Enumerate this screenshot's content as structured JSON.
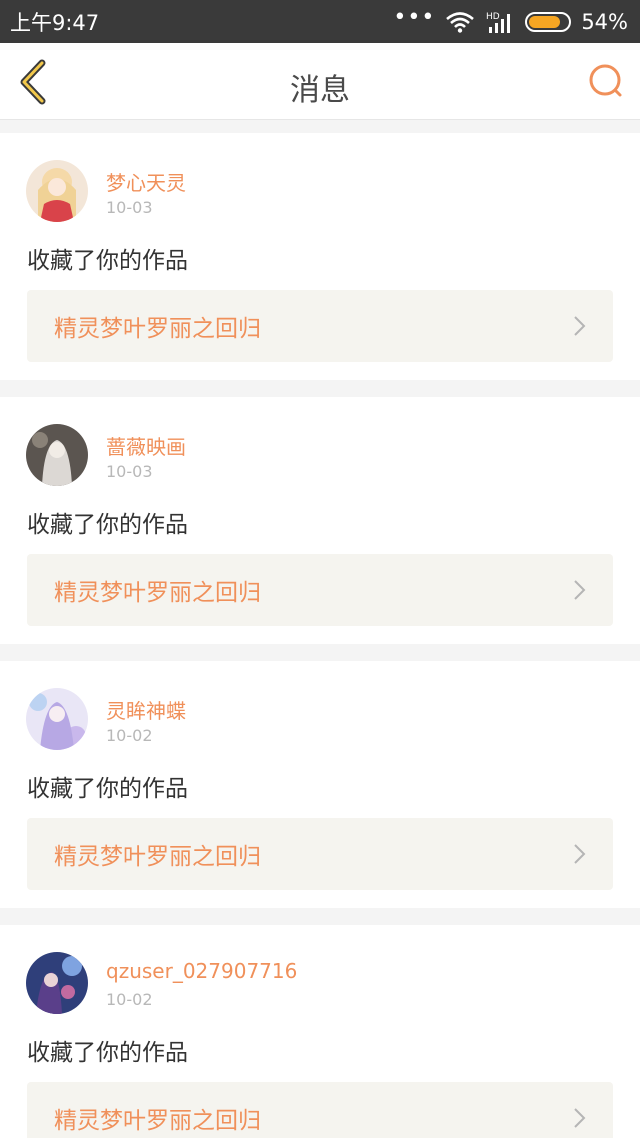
{
  "status_bar": {
    "time": "上午9:47",
    "dots": "•••",
    "network": "HD",
    "battery": "54%",
    "battery_level": 0.54,
    "battery_color": "#f6a623"
  },
  "header": {
    "title": "消息",
    "back_icon": "chevron-left-icon",
    "search_icon": "search-icon",
    "accent": "#f0905a"
  },
  "messages": [
    {
      "user": "梦心天灵",
      "date": "10-03",
      "action": "收藏了你的作品",
      "work": "精灵梦叶罗丽之回归"
    },
    {
      "user": "蔷薇映画",
      "date": "10-03",
      "action": "收藏了你的作品",
      "work": "精灵梦叶罗丽之回归"
    },
    {
      "user": "灵眸神蝶",
      "date": "10-02",
      "action": "收藏了你的作品",
      "work": "精灵梦叶罗丽之回归"
    },
    {
      "user": "qzuser_027907716",
      "date": "10-02",
      "action": "收藏了你的作品",
      "work": "精灵梦叶罗丽之回归"
    }
  ]
}
